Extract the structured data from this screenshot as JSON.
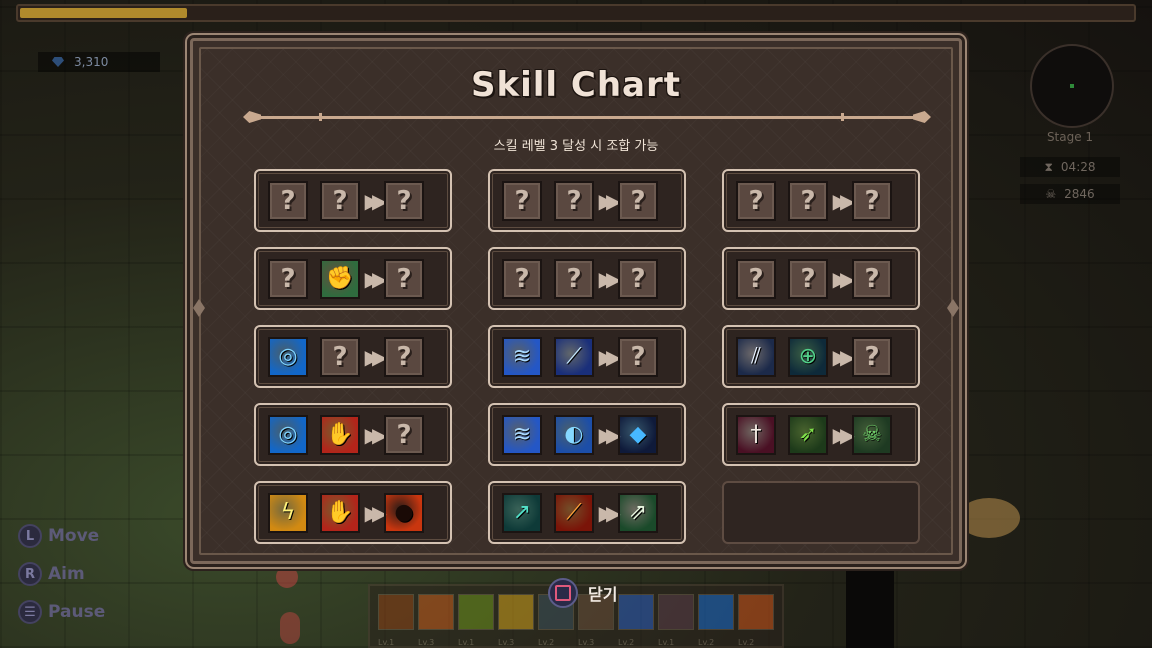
{
  "modal": {
    "title": "Skill Chart",
    "subtitle": "스킬 레벨 3 달성 시 조합 가능",
    "close_label": "닫기"
  },
  "hud": {
    "gems": "3,310",
    "stage": "Stage 1",
    "timer": "04:28",
    "kills": "2846",
    "progress_fraction": 0.15
  },
  "controls": [
    {
      "key": "L",
      "label": "Move"
    },
    {
      "key": "R",
      "label": "Aim"
    },
    {
      "key": "☰",
      "label": "Pause"
    }
  ],
  "unknown_mark": "?",
  "arrow_glyph": "▶▶",
  "recipes": [
    [
      "unknown",
      "unknown",
      "unknown"
    ],
    [
      "unknown",
      "unknown",
      "unknown"
    ],
    [
      "unknown",
      "unknown",
      "unknown"
    ],
    [
      "unknown",
      "fist-skill",
      "unknown"
    ],
    [
      "unknown",
      "unknown",
      "unknown"
    ],
    [
      "unknown",
      "unknown",
      "unknown"
    ],
    [
      "vortex-skill",
      "unknown",
      "unknown"
    ],
    [
      "ice-wave-skill",
      "ice-blade-skill",
      "unknown"
    ],
    [
      "triple-arrow-skill",
      "crosshair-skill",
      "unknown"
    ],
    [
      "vortex-skill",
      "flame-hand-skill",
      "unknown"
    ],
    [
      "ice-wave-skill",
      "water-orb-skill",
      "ice-crystal-skill"
    ],
    [
      "dagger-skill",
      "green-arrow-skill",
      "poison-skull-skill"
    ],
    [
      "lightning-scroll-skill",
      "flame-hand-skill",
      "meteor-skill"
    ],
    [
      "teal-spear-skill",
      "fire-strike-skill",
      "double-arrow-skill"
    ],
    null
  ],
  "icons": {
    "fist-skill": {
      "bg": "#2f6b3e",
      "fg": "#d9a27a",
      "glyph": "✊"
    },
    "vortex-skill": {
      "bg": "#1267c9",
      "fg": "#7fd3ff",
      "glyph": "◎"
    },
    "ice-wave-skill": {
      "bg": "#2457c6",
      "fg": "#a9d9ff",
      "glyph": "≋"
    },
    "ice-blade-skill": {
      "bg": "#1a2f7a",
      "fg": "#c8ecff",
      "glyph": "⟋"
    },
    "triple-arrow-skill": {
      "bg": "#1c2a4a",
      "fg": "#e8f2ff",
      "glyph": "⫽"
    },
    "crosshair-skill": {
      "bg": "#0e2a3a",
      "fg": "#52d18a",
      "glyph": "⊕"
    },
    "flame-hand-skill": {
      "bg": "#b3241a",
      "fg": "#ffd24a",
      "glyph": "✋"
    },
    "water-orb-skill": {
      "bg": "#1c4ea8",
      "fg": "#86d8ff",
      "glyph": "◐"
    },
    "ice-crystal-skill": {
      "bg": "#0f1a3a",
      "fg": "#47b8ff",
      "glyph": "◆"
    },
    "dagger-skill": {
      "bg": "#4a1024",
      "fg": "#f0e8e0",
      "glyph": "†"
    },
    "green-arrow-skill": {
      "bg": "#1d3a1a",
      "fg": "#7fe04a",
      "glyph": "➶"
    },
    "poison-skull-skill": {
      "bg": "#1e3a22",
      "fg": "#6fd16a",
      "glyph": "☠"
    },
    "lightning-scroll-skill": {
      "bg": "#d28a12",
      "fg": "#fff27a",
      "glyph": "ϟ"
    },
    "meteor-skill": {
      "bg": "#c9360f",
      "fg": "#1a0a06",
      "glyph": "●"
    },
    "teal-spear-skill": {
      "bg": "#0e3a38",
      "fg": "#52e0c8",
      "glyph": "↗"
    },
    "fire-strike-skill": {
      "bg": "#7a1408",
      "fg": "#ffa53a",
      "glyph": "⟋"
    },
    "double-arrow-skill": {
      "bg": "#1a4a2a",
      "fg": "#e8f6e0",
      "glyph": "⇗"
    }
  },
  "skillbar": {
    "slots": [
      "#8a3a14",
      "#c4541a",
      "#6a8a1a",
      "#d09a1a",
      "#3a4a5a",
      "#6a4a3a",
      "#2a5ac0",
      "#5a3a4a",
      "#1a6ad0",
      "#d0541a"
    ],
    "levels": [
      "Lv.1",
      "Lv.3",
      "Lv.1",
      "Lv.3",
      "Lv.2",
      "Lv.3",
      "Lv.2",
      "Lv.1",
      "Lv.2",
      "Lv.2"
    ]
  }
}
